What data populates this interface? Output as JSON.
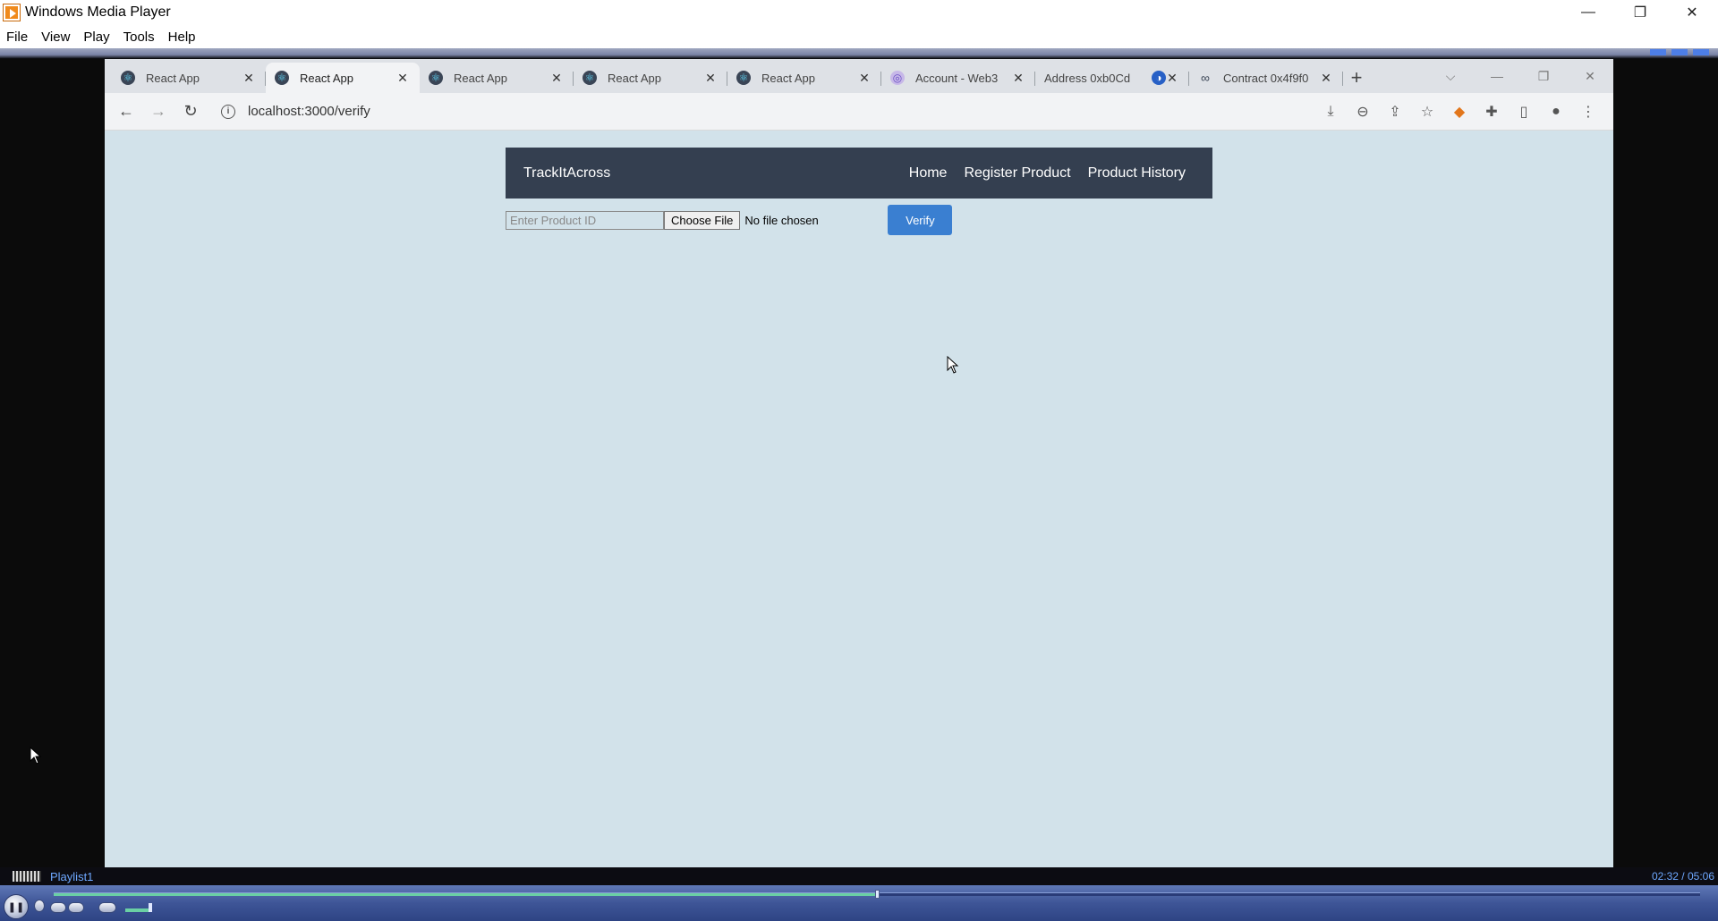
{
  "wmp": {
    "title": "Windows Media Player",
    "menu": [
      "File",
      "View",
      "Play",
      "Tools",
      "Help"
    ],
    "controls": {
      "minimize": "—",
      "restore": "❐",
      "close": "✕"
    },
    "playlist": "Playlist1",
    "time": "02:32 / 05:06",
    "progress_fraction": 0.5
  },
  "browser": {
    "tabs": [
      {
        "label": "React App",
        "favicon": "react-icon",
        "active": false
      },
      {
        "label": "React App",
        "favicon": "react-icon",
        "active": true
      },
      {
        "label": "React App",
        "favicon": "react-icon",
        "active": false
      },
      {
        "label": "React App",
        "favicon": "react-icon",
        "active": false
      },
      {
        "label": "React App",
        "favicon": "react-icon",
        "active": false
      },
      {
        "label": "Account - Web3",
        "favicon": "web3-icon",
        "active": false
      },
      {
        "label": "Address 0xb0Cd",
        "favicon": "address-icon",
        "active": false
      },
      {
        "label": "Contract 0x4f9f0",
        "favicon": "contract-icon",
        "active": false
      }
    ],
    "url": "localhost:3000/verify"
  },
  "app": {
    "brand": "TrackItAcross",
    "nav": {
      "home": "Home",
      "register": "Register Product",
      "history": "Product History"
    },
    "form": {
      "product_id_placeholder": "Enter Product ID",
      "choose_file": "Choose File",
      "file_status": "No file chosen",
      "verify": "Verify"
    }
  }
}
